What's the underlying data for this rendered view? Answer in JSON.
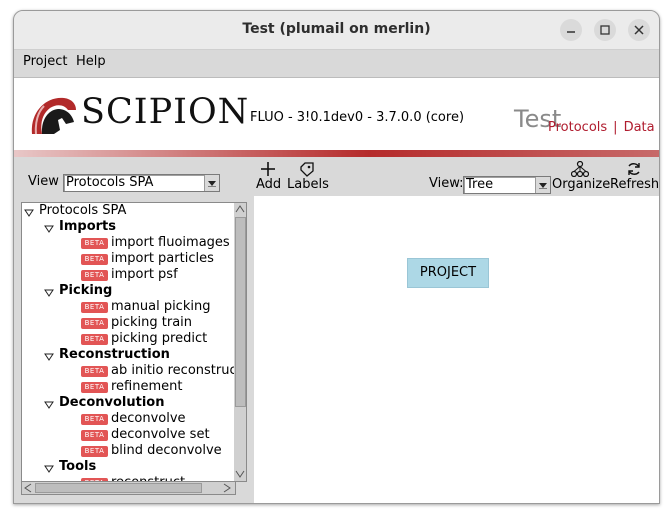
{
  "window": {
    "title": "Test (plumail on merlin)"
  },
  "menu": {
    "items": [
      "Project",
      "Help"
    ]
  },
  "header": {
    "logo_text": "SCIPION",
    "version": "FLUO - 3!0.1dev0 - 3.7.0.0 (core)",
    "project_name": "Test",
    "nav": {
      "protocols": "Protocols",
      "separator": "|",
      "data": "Data"
    }
  },
  "left_panel": {
    "view_label": "View",
    "view_value": "Protocols SPA",
    "tree": {
      "root": "Protocols SPA",
      "categories": [
        {
          "name": "Imports",
          "items": [
            "import fluoimages",
            "import particles",
            "import psf"
          ]
        },
        {
          "name": "Picking",
          "items": [
            "manual picking",
            "picking train",
            "picking predict"
          ]
        },
        {
          "name": "Reconstruction",
          "items": [
            "ab initio reconstruction",
            "refinement"
          ]
        },
        {
          "name": "Deconvolution",
          "items": [
            "deconvolve",
            "deconvolve set",
            "blind deconvolve"
          ]
        },
        {
          "name": "Tools",
          "items": [
            "reconstruct"
          ]
        }
      ],
      "badge": "BETA"
    }
  },
  "toolbar": {
    "add": "Add",
    "labels": "Labels",
    "view_label": "View:",
    "view_value": "Tree",
    "organize": "Organize",
    "refresh": "Refresh"
  },
  "graph": {
    "project_node": "PROJECT"
  },
  "colors": {
    "accent": "#b01c2e",
    "node": "#add8e6",
    "badge": "#e25555"
  }
}
